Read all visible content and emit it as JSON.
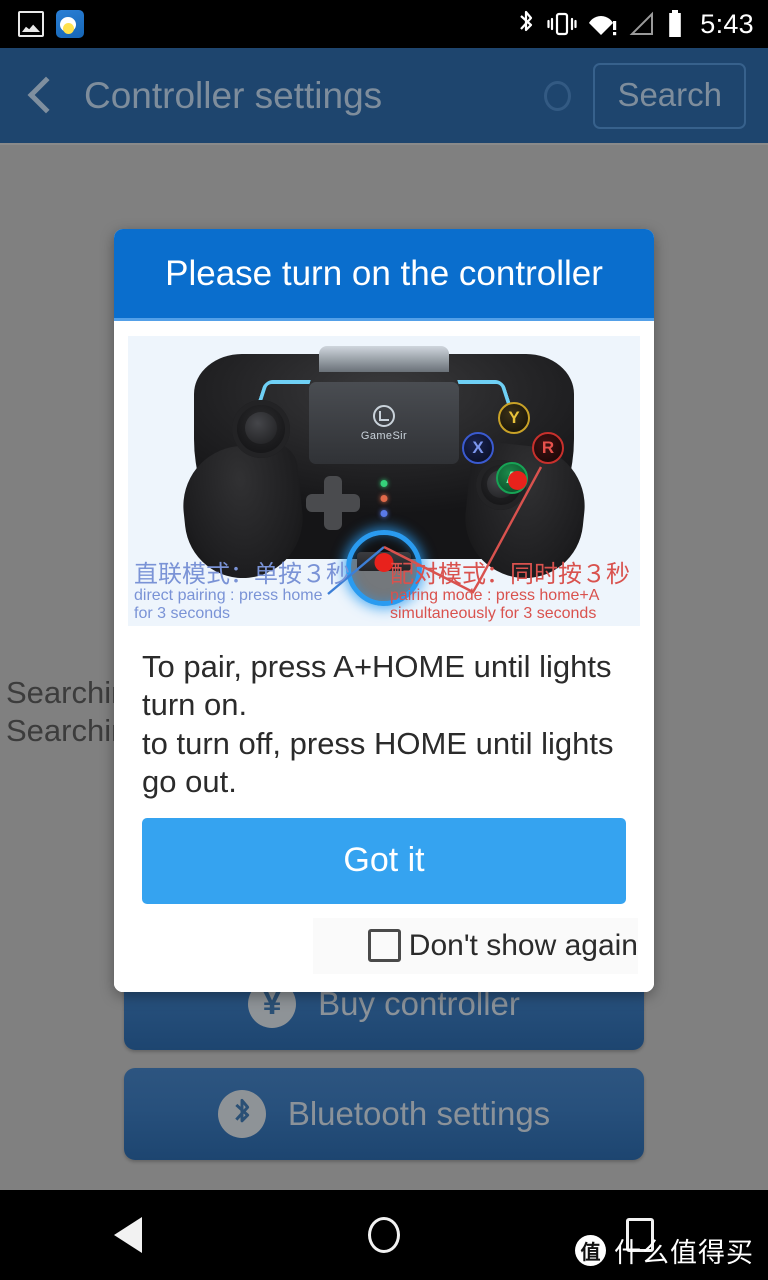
{
  "status_bar": {
    "left_icons": [
      {
        "name": "screenshot-icon",
        "label": "screenshot"
      },
      {
        "name": "app-notification-icon",
        "label": "app"
      }
    ],
    "right_icons": [
      {
        "name": "bluetooth-icon",
        "label": "bluetooth"
      },
      {
        "name": "vibrate-icon",
        "label": "vibrate"
      },
      {
        "name": "wifi-alert-icon",
        "label": "wifi-no-internet"
      },
      {
        "name": "cell-signal-icon",
        "label": "no-signal"
      },
      {
        "name": "battery-icon",
        "label": "battery-full"
      }
    ],
    "time": "5:43"
  },
  "app_bar": {
    "back_label": "Back",
    "title": "Controller settings",
    "search_label": "Search",
    "progress_label": "searching"
  },
  "background": {
    "status_lines": [
      "Searching",
      "Searching"
    ],
    "buttons": [
      {
        "name": "buy-controller",
        "icon": "yen-icon",
        "glyph": "¥",
        "label": "Buy controller"
      },
      {
        "name": "bluetooth-settings",
        "icon": "bluetooth-icon",
        "glyph": "",
        "label": "Bluetooth settings"
      }
    ]
  },
  "dialog": {
    "title": "Please turn on the controller",
    "message_lines": [
      "To pair, press A+HOME until lights turn on.",
      "to turn off, press HOME until lights go out."
    ],
    "primary_button": "Got it",
    "checkbox_label": "Don't show again",
    "checkbox_checked": false,
    "illustration": {
      "brand": "GameSir",
      "face_buttons": [
        "Y",
        "X",
        "R",
        "A"
      ],
      "captions": [
        {
          "cn": "直联模式：单按３秒",
          "en_line1": "direct pairing : press home",
          "en_line2": "for 3 seconds",
          "color": "#7a93d6"
        },
        {
          "cn": "配对模式：同时按３秒",
          "en_line1": "pairing mode : press home+A",
          "en_line2": "simultaneously for 3 seconds",
          "color": "#d9524e"
        }
      ]
    }
  },
  "nav_bar": {
    "back_label": "Back",
    "home_label": "Home",
    "recents_label": "Recents"
  },
  "watermark": {
    "badge": "值",
    "text": "什么值得买"
  },
  "colors": {
    "status_bar_bg": "#000000",
    "app_bar_bg": "#1e456e",
    "dialog_header_blue": "#0a6ecd",
    "primary_button_blue": "#35a3f0",
    "scrim_gray": "#808080",
    "bg_button_blue": "#27507c"
  }
}
